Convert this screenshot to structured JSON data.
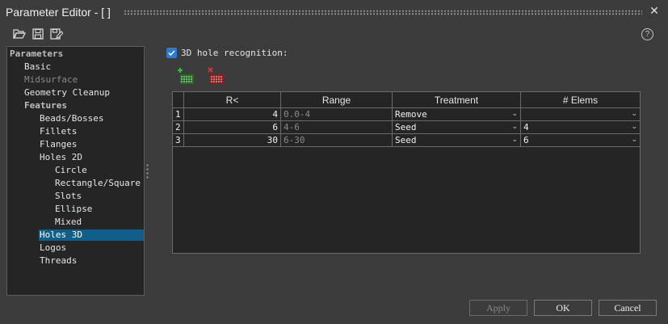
{
  "window": {
    "title": "Parameter Editor - [ ]"
  },
  "toolbar": {
    "open_icon": "folder-open-icon",
    "save_icon": "save-icon",
    "save_as_icon": "save-as-icon",
    "help_label": "?"
  },
  "tree": {
    "items": [
      {
        "label": "Parameters",
        "style": "bold"
      },
      {
        "label": "Basic",
        "style": "normal"
      },
      {
        "label": "Midsurface",
        "style": "dim"
      },
      {
        "label": "Geometry Cleanup",
        "style": "normal"
      },
      {
        "label": "Features",
        "style": "bold"
      },
      {
        "label": "Beads/Bosses",
        "style": "normal"
      },
      {
        "label": "Fillets",
        "style": "normal"
      },
      {
        "label": "Flanges",
        "style": "normal"
      },
      {
        "label": "Holes 2D",
        "style": "normal"
      },
      {
        "label": "Circle",
        "style": "normal"
      },
      {
        "label": "Rectangle/Square",
        "style": "normal"
      },
      {
        "label": "Slots",
        "style": "normal"
      },
      {
        "label": "Ellipse",
        "style": "normal"
      },
      {
        "label": "Mixed",
        "style": "normal"
      },
      {
        "label": "Holes 3D",
        "style": "selected"
      },
      {
        "label": "Logos",
        "style": "normal"
      },
      {
        "label": "Threads",
        "style": "normal"
      }
    ]
  },
  "main": {
    "recognition": {
      "label": "3D hole recognition:",
      "checked": true
    },
    "actions": {
      "add_row_icon": "add-row-icon",
      "delete_row_icon": "delete-row-icon"
    },
    "table": {
      "columns": [
        "R<",
        "Range",
        "Treatment",
        "# Elems"
      ],
      "rows": [
        {
          "num": "1",
          "r": "4",
          "range": "0.0-4",
          "treatment": "Remove",
          "elems": ""
        },
        {
          "num": "2",
          "r": "6",
          "range": "4-6",
          "treatment": "Seed",
          "elems": "4"
        },
        {
          "num": "3",
          "r": "30",
          "range": "6-30",
          "treatment": "Seed",
          "elems": "6"
        }
      ]
    }
  },
  "buttons": {
    "apply": "Apply",
    "ok": "OK",
    "cancel": "Cancel"
  },
  "colors": {
    "selection": "#0f5f8a",
    "checkbox": "#2b7bd1",
    "background": "#3c3c3c"
  }
}
